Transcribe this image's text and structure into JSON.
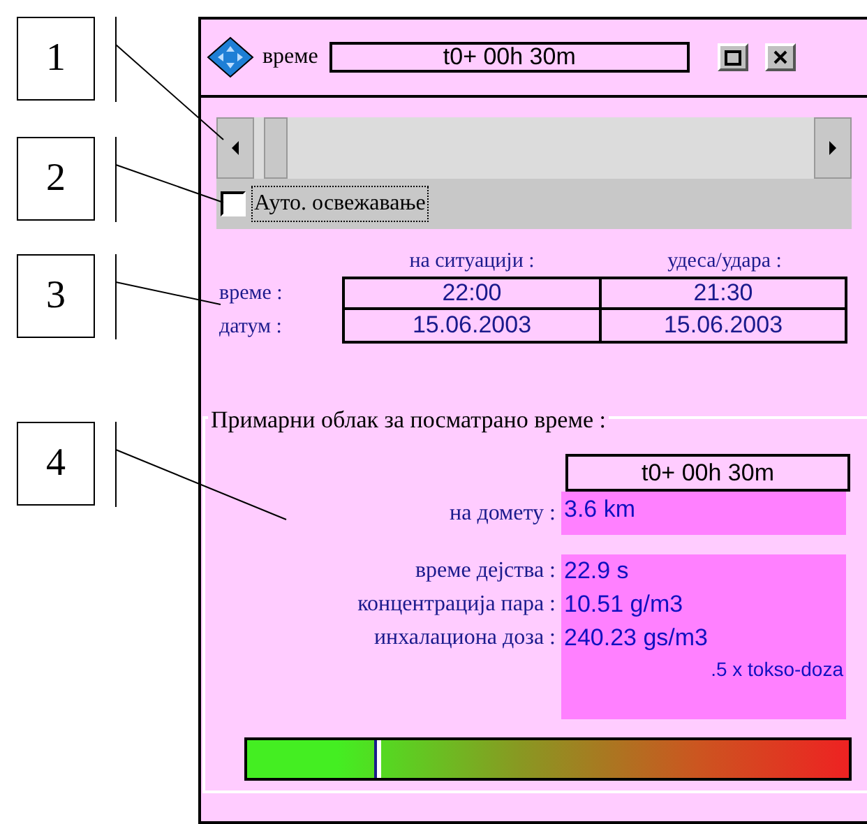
{
  "callouts": [
    {
      "label": "1"
    },
    {
      "label": "2"
    },
    {
      "label": "3"
    },
    {
      "label": "4"
    }
  ],
  "window": {
    "title": "време",
    "time": "t0+ 00h 30m"
  },
  "auto_refresh": {
    "label": "Ауто. освежавање",
    "checked": false
  },
  "times_table": {
    "columns": [
      "на ситуацији :",
      "удеса/удара :"
    ],
    "rows": [
      {
        "label": "време :",
        "cells": [
          "22:00",
          "21:30"
        ]
      },
      {
        "label": "датум :",
        "cells": [
          "15.06.2003",
          "15.06.2003"
        ]
      }
    ]
  },
  "primary_cloud": {
    "title": "Примарни облак за посматрано време :",
    "time": "t0+ 00h 30m",
    "range": {
      "label": "на домету :",
      "value": "3.6 km"
    },
    "metrics": [
      {
        "label": "време дејства :",
        "value": "22.9 s"
      },
      {
        "label": "концентрација пара :",
        "value": "10.51 g/m3"
      },
      {
        "label": "инхалациона доза :",
        "value": "240.23 gs/m3"
      }
    ],
    "note": ".5 x tokso-doza",
    "hazard_meter": {
      "level": 0.21
    }
  }
}
